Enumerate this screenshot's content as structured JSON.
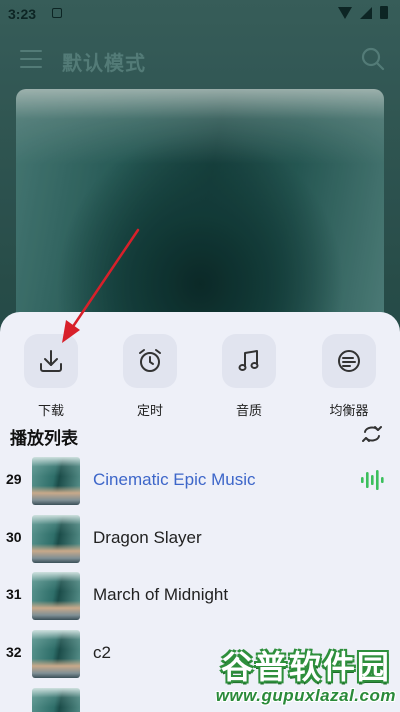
{
  "status_bar": {
    "time": "3:23"
  },
  "app_bar": {
    "title": "默认模式"
  },
  "actions": [
    {
      "label": "下载",
      "icon": "download-icon"
    },
    {
      "label": "定时",
      "icon": "alarm-clock-icon"
    },
    {
      "label": "音质",
      "icon": "music-note-icon"
    },
    {
      "label": "均衡器",
      "icon": "equalizer-icon"
    }
  ],
  "playlist": {
    "heading": "播放列表",
    "tracks": [
      {
        "num": "29",
        "title": "Cinematic Epic Music",
        "playing": true
      },
      {
        "num": "30",
        "title": "Dragon Slayer",
        "playing": false
      },
      {
        "num": "31",
        "title": "March of Midnight",
        "playing": false
      },
      {
        "num": "32",
        "title": "c2",
        "playing": false
      }
    ]
  },
  "watermark": {
    "line1": "谷普软件园",
    "line2": "www.gupuxlazal.com"
  },
  "colors": {
    "accent_playing": "#3d66c9",
    "equalizer_green": "#3bbf5c",
    "sheet_bg": "#eef0f8",
    "annotation_arrow": "#d8202a"
  }
}
